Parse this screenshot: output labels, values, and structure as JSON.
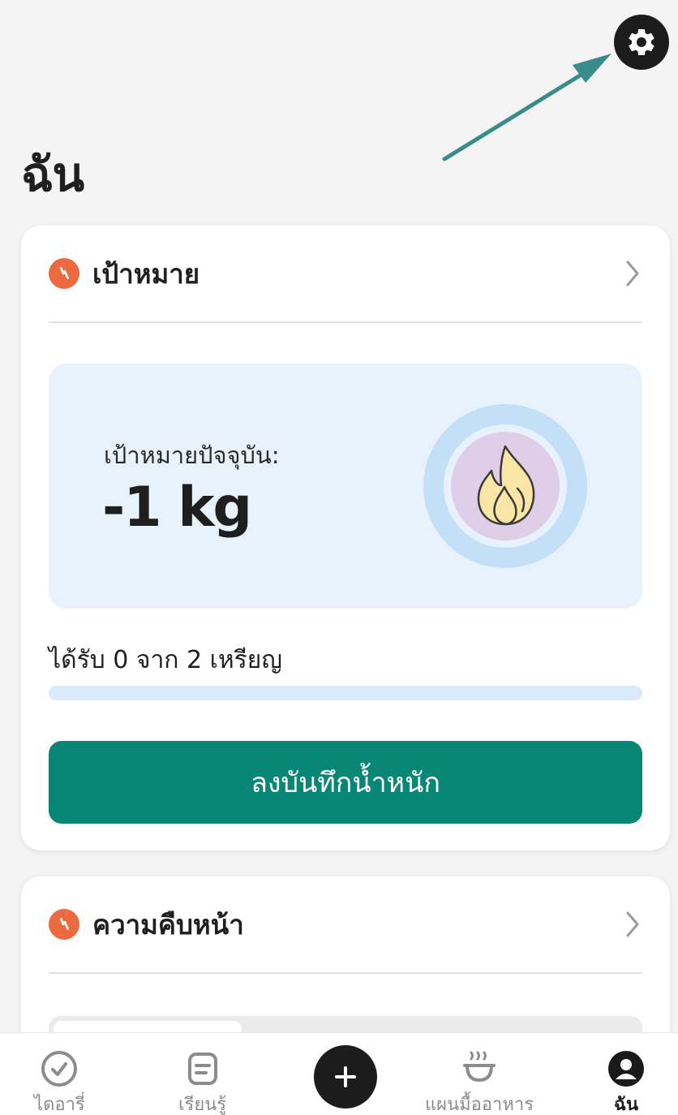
{
  "page": {
    "title": "ฉัน"
  },
  "goal_card": {
    "title": "เป้าหมาย",
    "current_goal_label": "เป้าหมายปัจจุบัน:",
    "current_goal_value": "-1 kg",
    "medals_text": "ได้รับ 0 จาก 2 เหรียญ",
    "medals_earned": 0,
    "medals_total": 2,
    "log_weight_button": "ลงบันทึกน้ำหนัก"
  },
  "progress_card": {
    "title": "ความคืบหน้า"
  },
  "bottom_nav": {
    "items": [
      {
        "label": "ไดอารี่",
        "icon": "check-circle-icon",
        "active": false
      },
      {
        "label": "เรียนรู้",
        "icon": "article-icon",
        "active": false
      },
      {
        "label": "",
        "icon": "plus-icon",
        "active": false
      },
      {
        "label": "แผนมื้ออาหาร",
        "icon": "bowl-icon",
        "active": false
      },
      {
        "label": "ฉัน",
        "icon": "profile-icon",
        "active": true
      }
    ]
  },
  "colors": {
    "accent": "#0a8676",
    "badge": "#ec6a3f",
    "arrow": "#3a8c8a",
    "goal_box": "#e8f2fc"
  }
}
